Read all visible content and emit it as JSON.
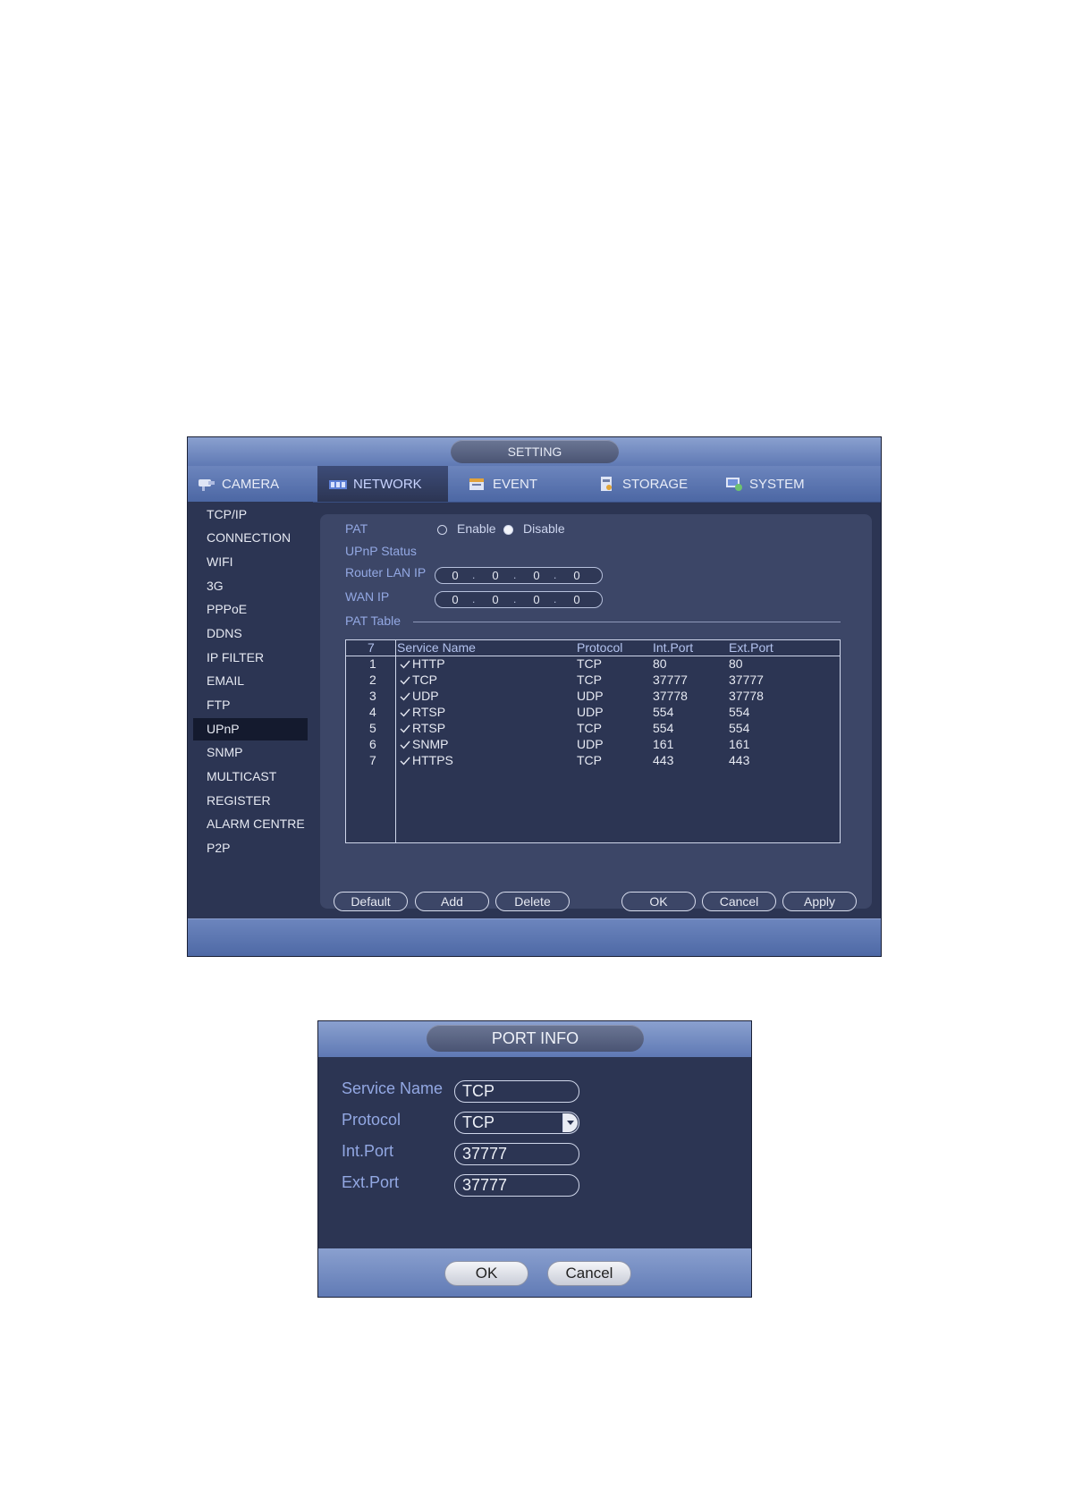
{
  "setting": {
    "title": "SETTING",
    "tabs": [
      {
        "label": "CAMERA",
        "icon": "camera-icon"
      },
      {
        "label": "NETWORK",
        "icon": "network-icon"
      },
      {
        "label": "EVENT",
        "icon": "event-icon"
      },
      {
        "label": "STORAGE",
        "icon": "storage-icon"
      },
      {
        "label": "SYSTEM",
        "icon": "system-icon"
      }
    ],
    "active_tab": "NETWORK",
    "sidebar": [
      "TCP/IP",
      "CONNECTION",
      "WIFI",
      "3G",
      "PPPoE",
      "DDNS",
      "IP FILTER",
      "EMAIL",
      "FTP",
      "UPnP",
      "SNMP",
      "MULTICAST",
      "REGISTER",
      "ALARM CENTRE",
      "P2P"
    ],
    "active_sidebar": "UPnP",
    "form": {
      "pat_label": "PAT",
      "enable_label": "Enable",
      "disable_label": "Disable",
      "pat_value": "Disable",
      "upnp_status_label": "UPnP Status",
      "router_lan_ip_label": "Router LAN IP",
      "router_lan_ip": [
        "0",
        "0",
        "0",
        "0"
      ],
      "wan_ip_label": "WAN IP",
      "wan_ip": [
        "0",
        "0",
        "0",
        "0"
      ],
      "pat_table_label": "PAT Table"
    },
    "table": {
      "count": "7",
      "headers": [
        "Service Name",
        "Protocol",
        "Int.Port",
        "Ext.Port"
      ],
      "rows": [
        {
          "no": "1",
          "name": "HTTP",
          "protocol": "TCP",
          "int_port": "80",
          "ext_port": "80",
          "checked": true
        },
        {
          "no": "2",
          "name": "TCP",
          "protocol": "TCP",
          "int_port": "37777",
          "ext_port": "37777",
          "checked": true
        },
        {
          "no": "3",
          "name": "UDP",
          "protocol": "UDP",
          "int_port": "37778",
          "ext_port": "37778",
          "checked": true
        },
        {
          "no": "4",
          "name": "RTSP",
          "protocol": "UDP",
          "int_port": "554",
          "ext_port": "554",
          "checked": true
        },
        {
          "no": "5",
          "name": "RTSP",
          "protocol": "TCP",
          "int_port": "554",
          "ext_port": "554",
          "checked": true
        },
        {
          "no": "6",
          "name": "SNMP",
          "protocol": "UDP",
          "int_port": "161",
          "ext_port": "161",
          "checked": true
        },
        {
          "no": "7",
          "name": "HTTPS",
          "protocol": "TCP",
          "int_port": "443",
          "ext_port": "443",
          "checked": true
        }
      ]
    },
    "buttons": {
      "default": "Default",
      "add": "Add",
      "delete": "Delete",
      "ok": "OK",
      "cancel": "Cancel",
      "apply": "Apply"
    }
  },
  "port_info": {
    "title": "PORT INFO",
    "service_name_label": "Service Name",
    "service_name": "TCP",
    "protocol_label": "Protocol",
    "protocol": "TCP",
    "int_port_label": "Int.Port",
    "int_port": "37777",
    "ext_port_label": "Ext.Port",
    "ext_port": "37777",
    "ok": "OK",
    "cancel": "Cancel"
  }
}
